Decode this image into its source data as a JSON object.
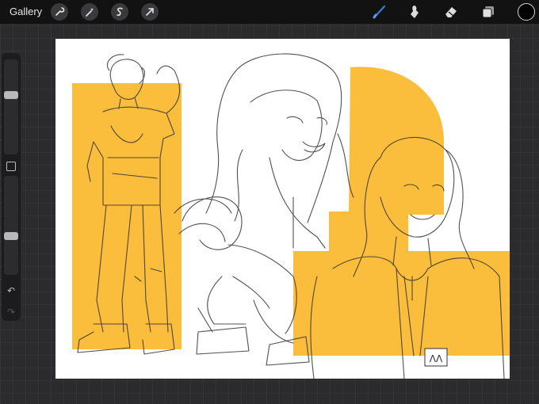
{
  "topbar": {
    "gallery_label": "Gallery",
    "left_tools": [
      "wrench-icon",
      "magic-wand-icon",
      "selection-icon",
      "transform-arrow-icon"
    ],
    "right_tools": [
      "brush-icon",
      "smudge-icon",
      "eraser-icon",
      "layers-icon"
    ],
    "active_tool": "brush",
    "active_tool_color": "#3a7bd5",
    "current_color": "#000000"
  },
  "sidebar": {
    "brush_size_level": 0.36,
    "opacity_level": 0.62,
    "modify_button": "square-icon",
    "undo": "undo-icon",
    "redo": "redo-icon"
  },
  "canvas": {
    "background": "#ffffff",
    "accent_color": "#fbbd3c",
    "signature": "ΛΛ"
  }
}
